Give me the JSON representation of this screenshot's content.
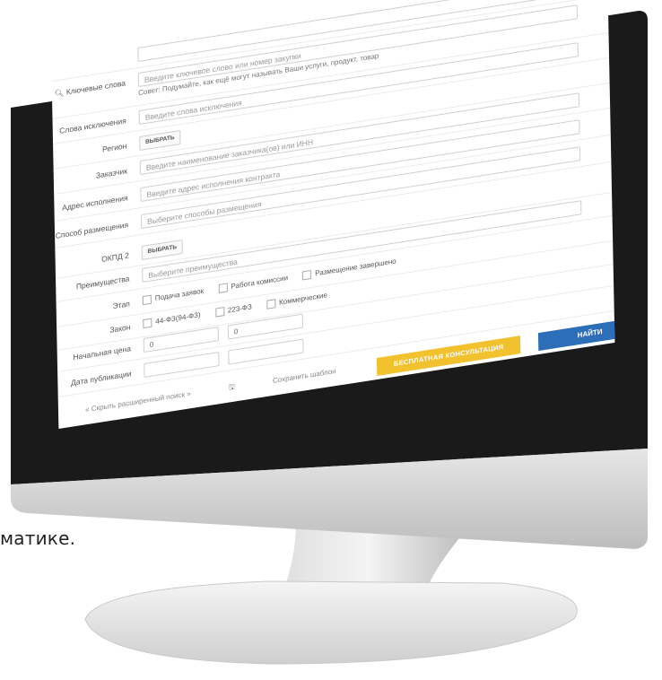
{
  "caption": "матике.",
  "form": {
    "keywords": {
      "label": "Ключевые слова",
      "placeholder": "Введите ключевое слово или номер закупки",
      "hint": "Совет: Подумайте, как ещё могут называть Ваши услуги, продукт, товар"
    },
    "exclusions": {
      "label": "Слова исключения",
      "placeholder": "Введите слова исключения"
    },
    "region": {
      "label": "Регион",
      "button": "ВЫБРАТЬ"
    },
    "customer": {
      "label": "Заказчик",
      "placeholder": "Введите наименование заказчика(ов) или ИНН"
    },
    "address": {
      "label": "Адрес исполнения",
      "placeholder": "Введите адрес исполнения контракта"
    },
    "method": {
      "label": "Способ размещения",
      "placeholder": "Выберите способы размещения"
    },
    "okpd": {
      "label": "ОКПД 2",
      "button": "ВЫБРАТЬ"
    },
    "advantages": {
      "label": "Преимущества",
      "placeholder": "Выберите преимущества"
    },
    "stage": {
      "label": "Этап",
      "options": [
        "Подача заявок",
        "Работа комиссии",
        "Размещение завершено"
      ]
    },
    "law": {
      "label": "Закон",
      "options": [
        "44-ФЗ(94-ФЗ)",
        "223-ФЗ",
        "Коммерческие"
      ]
    },
    "price": {
      "label": "Начальная цена",
      "from": "0",
      "to": "0"
    },
    "date": {
      "label": "Дата публикации",
      "from": "",
      "to": ""
    }
  },
  "footer": {
    "hide_search": "« Скрыть расширенный поиск »",
    "save_template": "Сохранить шаблон",
    "consult_button": "БЕСПЛАТНАЯ КОНСУЛЬТАЦИЯ",
    "find_button": "НАЙТИ"
  }
}
